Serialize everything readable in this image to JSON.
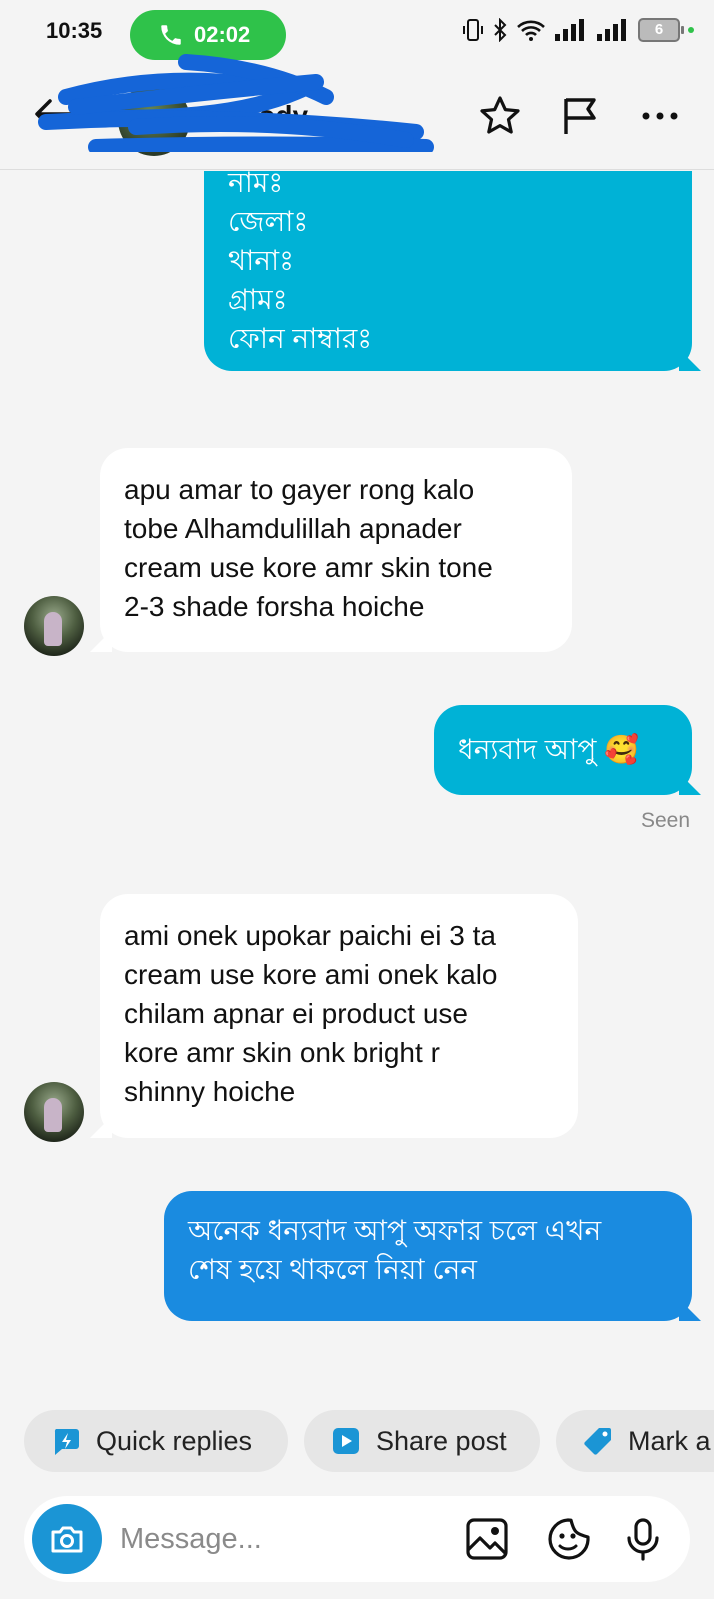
{
  "status_bar": {
    "time": "10:35",
    "call_timer": "02:02",
    "battery": "6"
  },
  "header": {
    "contact_name": "melody"
  },
  "messages": [
    {
      "direction": "out",
      "lines": [
        "নামঃ",
        "জেলাঃ",
        "থানাঃ",
        "গ্রামঃ",
        "ফোন নাম্বারঃ"
      ]
    },
    {
      "direction": "in",
      "lines": [
        "apu amar to gayer rong kalo",
        "tobe Alhamdulillah apnader",
        "cream use kore amr skin tone",
        "2-3 shade forsha hoiche"
      ]
    },
    {
      "direction": "out",
      "lines": [
        "ধন্যবাদ আপু 🥰"
      ],
      "status": "Seen"
    },
    {
      "direction": "in",
      "lines": [
        "ami onek upokar paichi ei 3 ta",
        "cream use kore ami onek kalo",
        "chilam apnar ei product use",
        "kore amr skin onk bright r",
        "shinny hoiche"
      ]
    },
    {
      "direction": "out",
      "lines": [
        "অনেক ধন্যবাদ আপু অফার চলে এখন",
        "শেষ হয়ে থাকলে নিয়া নেন"
      ]
    }
  ],
  "quick_actions": [
    {
      "label": "Quick replies",
      "icon": "bolt-icon"
    },
    {
      "label": "Share post",
      "icon": "play-icon"
    },
    {
      "label": "Mark a",
      "icon": "tag-icon"
    }
  ],
  "composer": {
    "placeholder": "Message..."
  },
  "colors": {
    "outgoing_teal": "#00b2d6",
    "outgoing_blue": "#1a8be0",
    "accent": "#1b95d5",
    "call_green": "#2fc24a"
  }
}
